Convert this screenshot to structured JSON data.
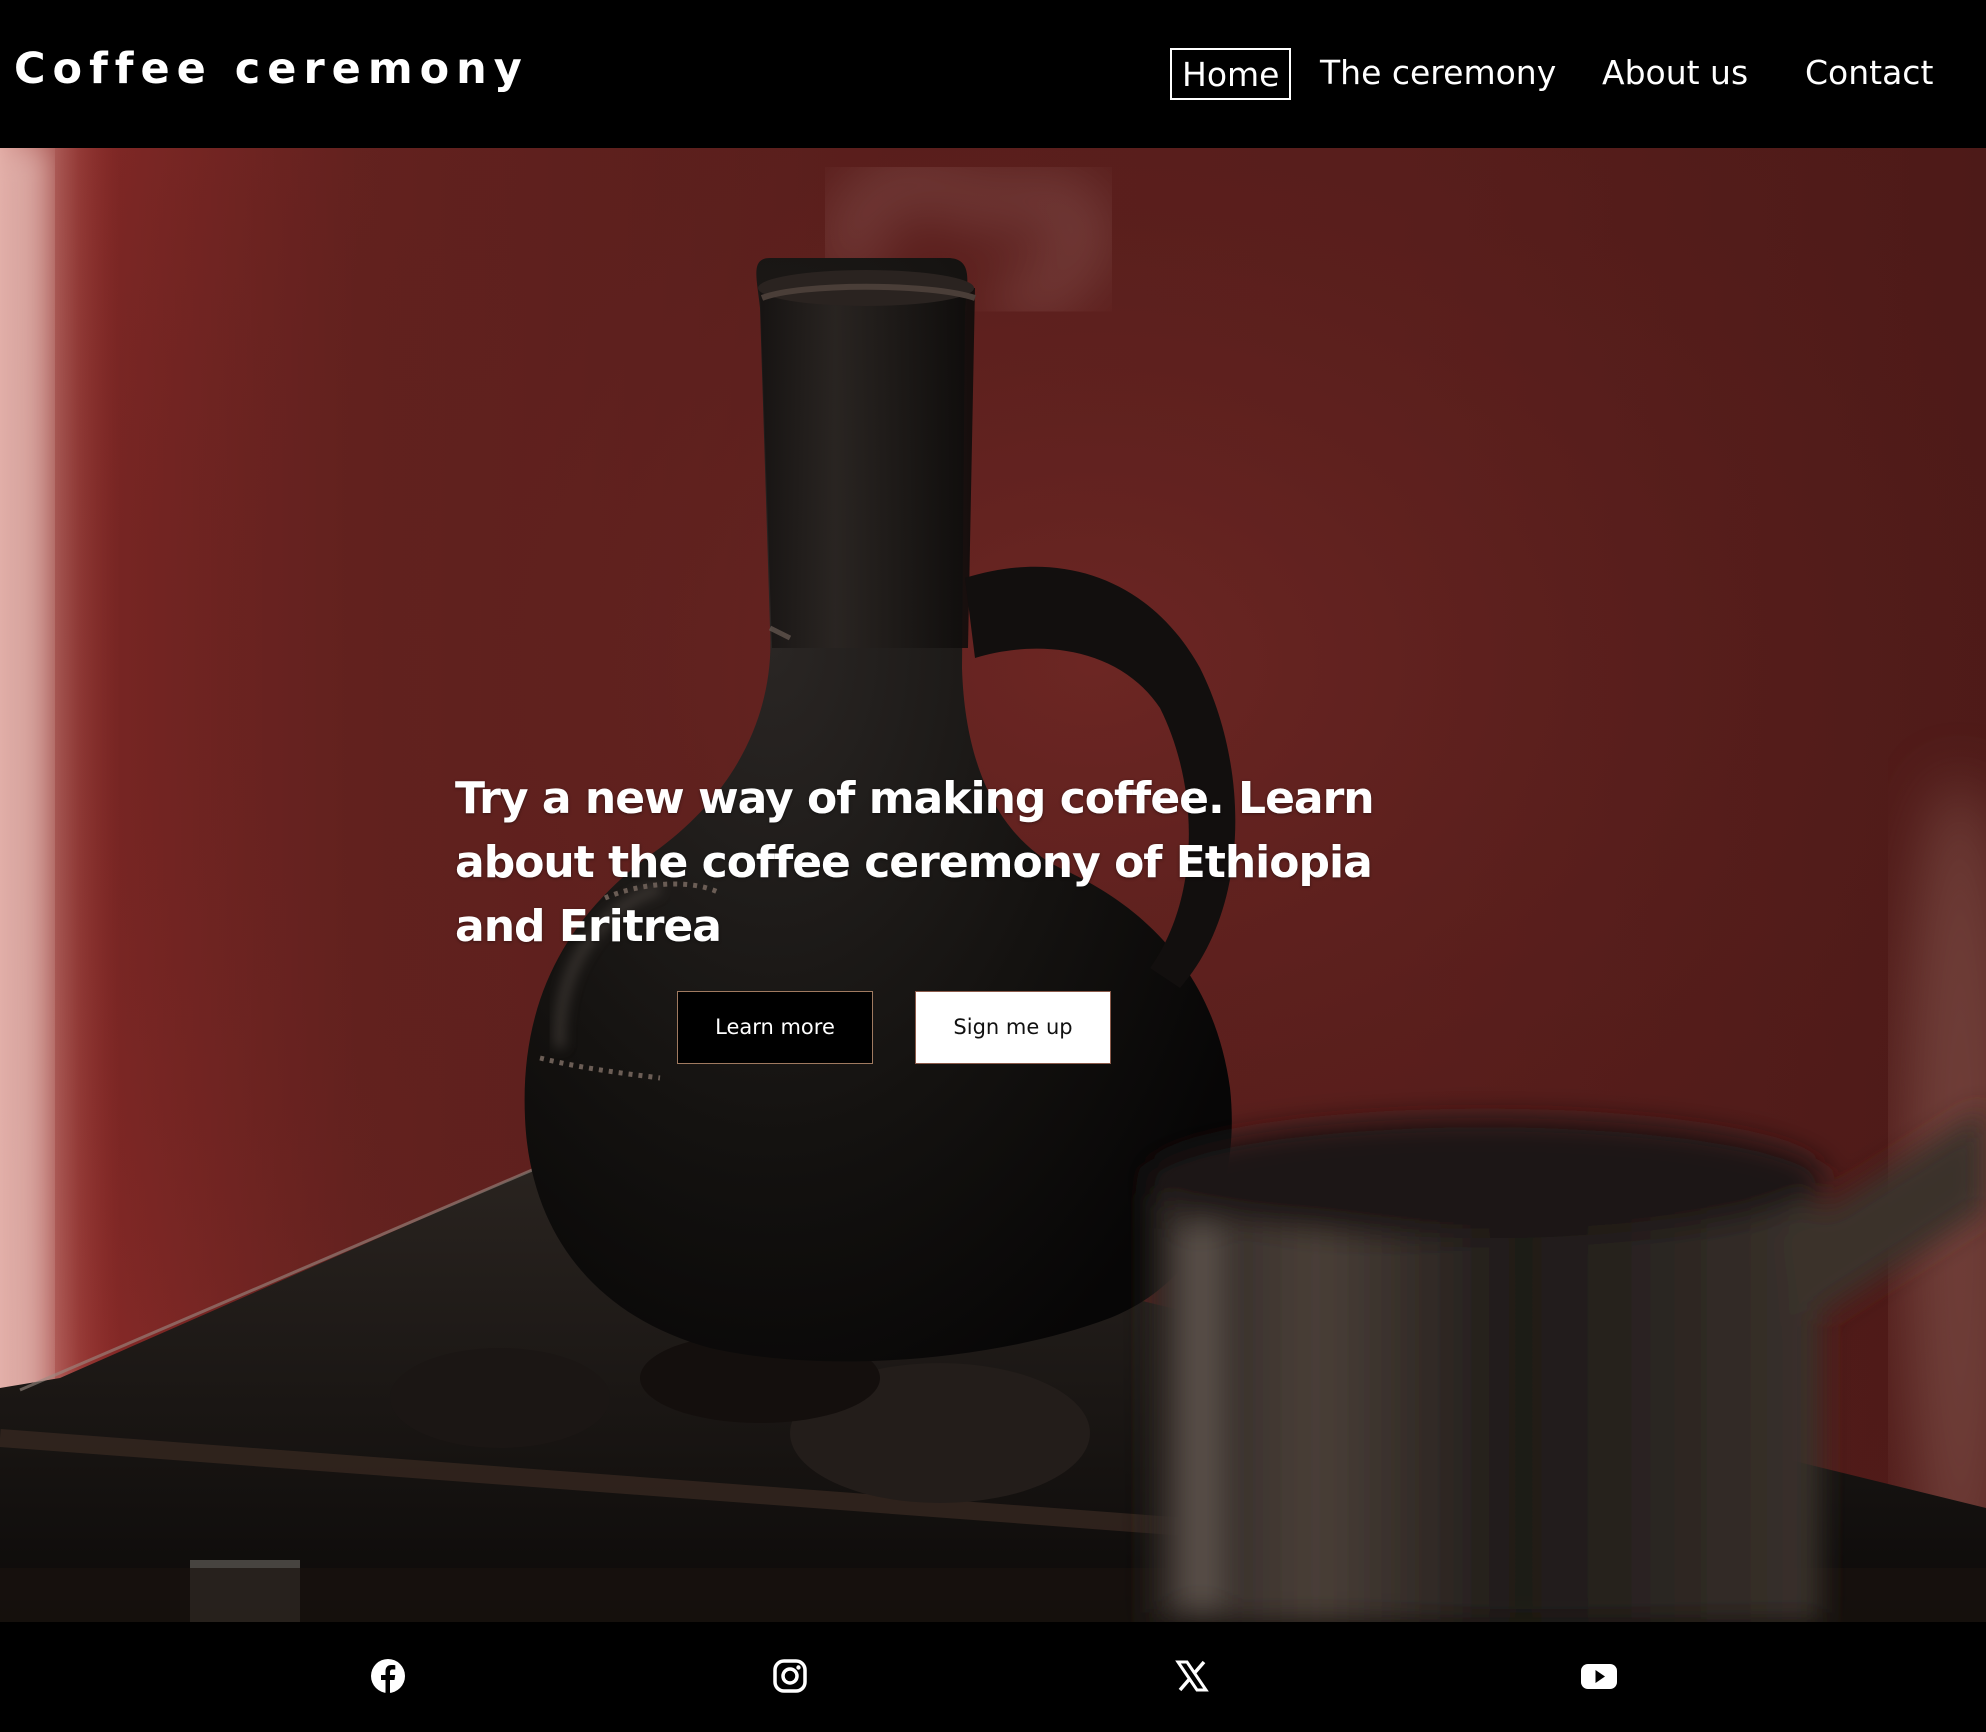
{
  "header": {
    "brand": "Coffee ceremony",
    "nav": [
      {
        "label": "Home",
        "active": true
      },
      {
        "label": "The ceremony"
      },
      {
        "label": "About us"
      },
      {
        "label": "Contact"
      }
    ]
  },
  "hero": {
    "headline": "Try a new way of making coffee. Learn about the coffee ceremony of Ethiopia and Eritrea",
    "buttons": {
      "learn_more": "Learn more",
      "sign_up": "Sign me up"
    }
  },
  "footer": {
    "social_icons": [
      "facebook-icon",
      "instagram-icon",
      "x-icon",
      "youtube-icon"
    ]
  },
  "colors": {
    "background": "#000000",
    "hero_wall": "#5c1f1d",
    "text": "#ffffff"
  }
}
